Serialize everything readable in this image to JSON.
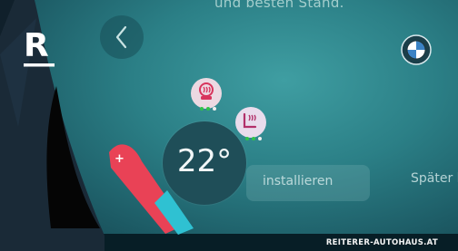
{
  "header": {
    "partial_text": "und besten Stand."
  },
  "climate": {
    "temperature": "22°",
    "plus_symbol": "+"
  },
  "actions": {
    "install_label": "installieren",
    "later_label": "Später le"
  },
  "overlay": {
    "watermark": "REITERER-AUTOHAUS.AT",
    "logo_letter": "R"
  },
  "colors": {
    "screen": "#2b7f86",
    "slider_red": "#e94256",
    "slider_cyan": "#2fc1d2"
  },
  "icons": {
    "back": "chevron-left-icon",
    "brand": "bmw-roundel-icon",
    "heat": "seat-heating-icon",
    "vent": "seat-ventilation-icon"
  }
}
